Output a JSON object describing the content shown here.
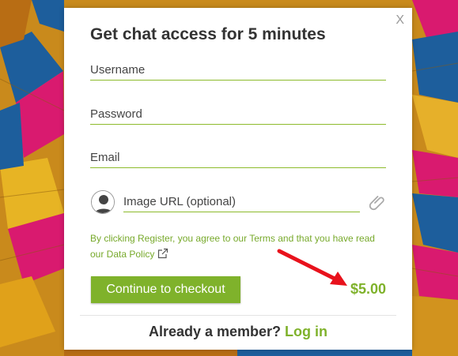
{
  "modal": {
    "title": "Get chat access for 5 minutes",
    "close_label": "X",
    "fields": {
      "username_placeholder": "Username",
      "password_placeholder": "Password",
      "email_placeholder": "Email",
      "image_url_placeholder": "Image URL (optional)"
    },
    "legal_text": "By clicking Register, you agree to our Terms and that you have read our Data Policy",
    "checkout_label": "Continue to checkout",
    "price": "$5.00",
    "footer_prompt": "Already a member?",
    "footer_link": "Log in"
  },
  "icons": [
    "avatar-icon",
    "paperclip-icon",
    "external-link-icon",
    "arrow-annotation"
  ],
  "colors": {
    "accent_green": "#7fb22b",
    "field_underline": "#8dbb2c",
    "arrow_red": "#e8121c",
    "title_text": "#333333"
  }
}
